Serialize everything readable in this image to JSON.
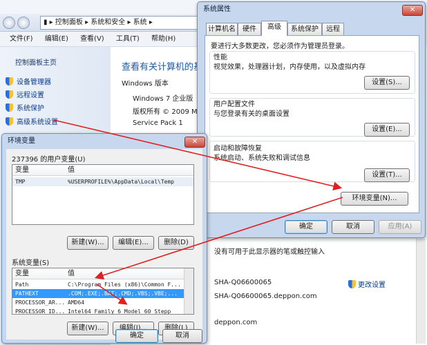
{
  "control_panel": {
    "breadcrumb": [
      "控制面板",
      "系统和安全",
      "系统"
    ],
    "menu": [
      "文件(F)",
      "编辑(E)",
      "查看(V)",
      "工具(T)",
      "帮助(H)"
    ],
    "side_home": "控制面板主页",
    "side_links": [
      "设备管理器",
      "远程设置",
      "系统保护",
      "高级系统设置"
    ],
    "main_title": "查看有关计算机的基",
    "windows_edition_label": "Windows 版本",
    "edition": "Windows 7 企业版",
    "copyright": "版权所有 © 2009 Mic",
    "service_pack": "Service Pack 1",
    "pen_touch": "没有可用于此显示器的笔或触控输入",
    "computer_name": "SHA-Q06600065",
    "change_settings": "更改设置",
    "full_name": "SHA-Q06600065.deppon.com",
    "domain": "deppon.com"
  },
  "sys_props": {
    "title": "系统属性",
    "close": "✕",
    "tabs": [
      "计算机名",
      "硬件",
      "高级",
      "系统保护",
      "远程"
    ],
    "admin_note": "要进行大多数更改，您必须作为管理员登录。",
    "perf_title": "性能",
    "perf_desc": "视觉效果，处理器计划，内存使用，以及虚拟内存",
    "profile_title": "用户配置文件",
    "profile_desc": "与您登录有关的桌面设置",
    "startup_title": "启动和故障恢复",
    "startup_desc": "系统启动、系统失败和调试信息",
    "settings_btn1": "设置(S)...",
    "settings_btn2": "设置(E)...",
    "settings_btn3": "设置(T)...",
    "env_btn": "环境变量(N)...",
    "ok": "确定",
    "cancel": "取消",
    "apply": "应用(A)"
  },
  "env_vars": {
    "title": "环境变量",
    "close": "✕",
    "user_label": "237396 的用户变量(U)",
    "col_var": "变量",
    "col_val": "值",
    "user_rows": [
      {
        "var": "TMP",
        "val": "%USERPROFILE%\\AppData\\Local\\Temp"
      }
    ],
    "sys_label": "系统变量(S)",
    "sys_rows": [
      {
        "var": "Path",
        "val": "C:\\Program Files (x86)\\Common F..."
      },
      {
        "var": "PATHEXT",
        "val": ".COM;.EXE;.BAT;.CMD;.VBS;.VBE;..."
      },
      {
        "var": "PROCESSOR_AR...",
        "val": "AMD64"
      },
      {
        "var": "PROCESSOR_ID...",
        "val": "Intel64 Family 6 Model 60 Stepp"
      }
    ],
    "new_btn": "新建(W)...",
    "edit_btn": "编辑(E)...",
    "delete_btn": "删除(D)",
    "new_btn2": "新建(W)...",
    "edit_btn2": "编辑(I)...",
    "delete_btn2": "删除(L)",
    "ok": "确定",
    "cancel": "取消"
  },
  "colors": {
    "arrow": "#e02020",
    "selection": "#3399ff",
    "link": "#0c3b8a"
  }
}
